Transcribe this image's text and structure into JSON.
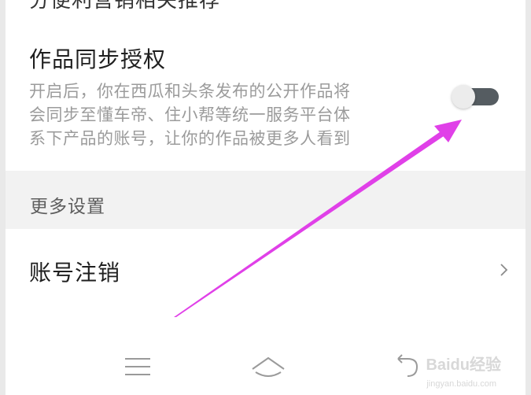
{
  "top_cut_text": "分便利营销相关推荐",
  "sync_setting": {
    "title": "作品同步授权",
    "description_lines": [
      "开启后，你在西瓜和头条发布的公开作品将",
      "会同步至懂车帝、住小帮等统一服务平台体",
      "系下产品的账号，让你的作品被更多人看到"
    ],
    "toggle_state": "off"
  },
  "more_settings": {
    "header": "更多设置",
    "items": [
      {
        "label": "账号注销"
      }
    ]
  },
  "navigation_bar": {
    "buttons": [
      "menu-icon",
      "home-icon",
      "back-icon"
    ]
  },
  "annotation": {
    "arrow_color": "#e040e8"
  },
  "watermark": {
    "brand": "Baidu经验",
    "sub": "jingyan.baidu.com"
  }
}
